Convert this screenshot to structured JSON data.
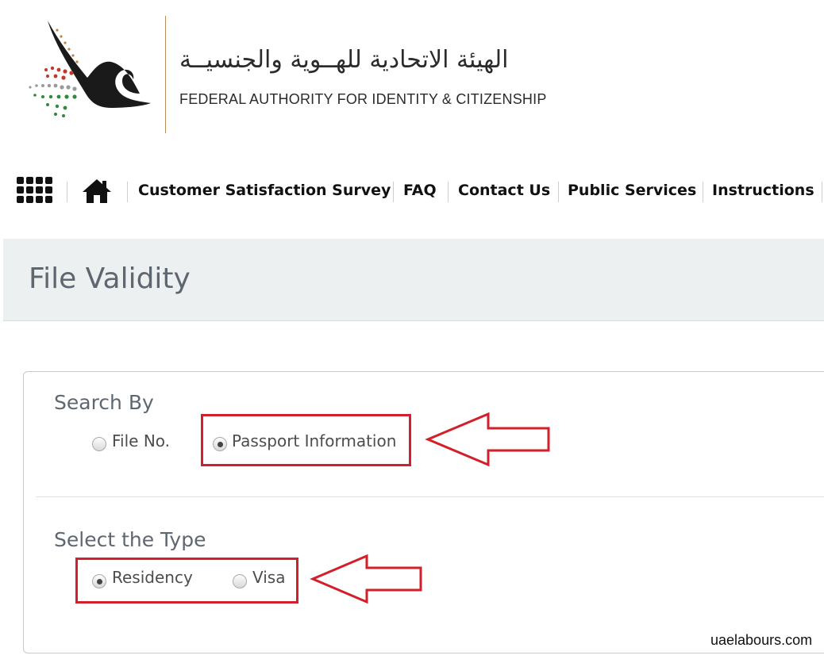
{
  "header": {
    "arabic_name": "الهيئة الاتحادية للهــوية والجنسيــة",
    "english_name": "FEDERAL AUTHORITY FOR IDENTITY & CITIZENSHIP"
  },
  "nav": {
    "menu_icon": "grid-menu-icon",
    "home_icon": "home-icon",
    "links": [
      "Customer Satisfaction Survey",
      "FAQ",
      "Contact Us",
      "Public Services",
      "Instructions"
    ]
  },
  "page": {
    "title": "File Validity"
  },
  "form": {
    "search_by": {
      "label": "Search By",
      "options": [
        "File No.",
        "Passport Information"
      ],
      "selected": "Passport Information"
    },
    "type": {
      "label": "Select the Type",
      "options": [
        "Residency",
        "Visa"
      ],
      "selected": "Residency"
    }
  },
  "colors": {
    "annotation_red": "#d21f2b",
    "title_band": "#edf0f1",
    "logo_divider": "#b98a5a"
  },
  "watermark": "uaelabours.com"
}
